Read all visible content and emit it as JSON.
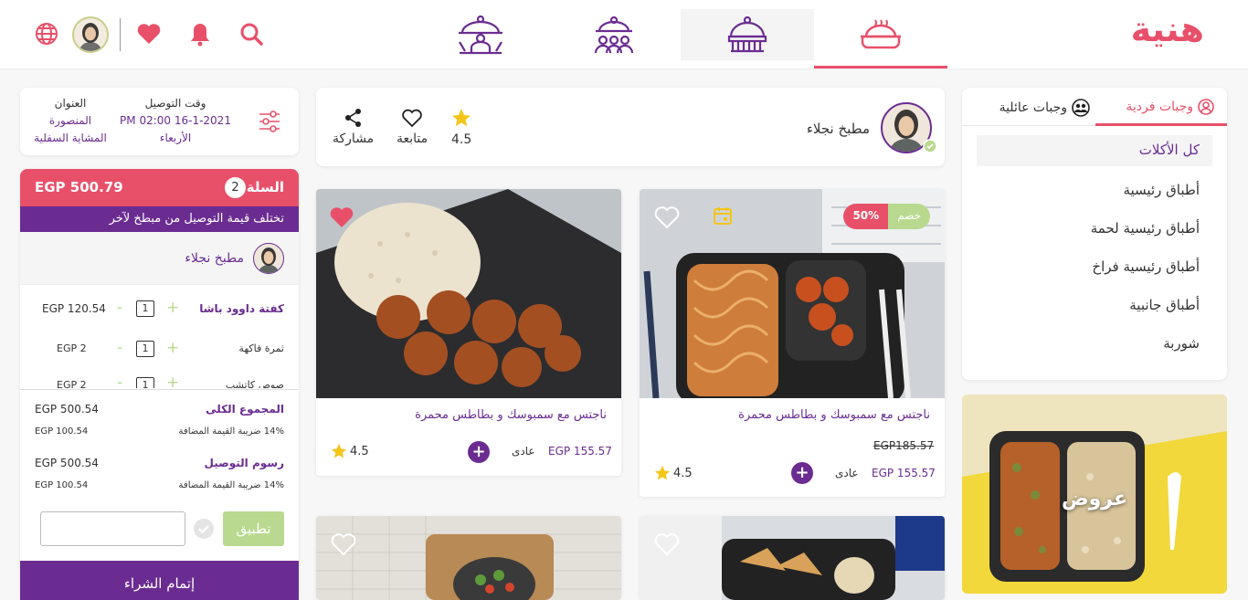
{
  "header": {
    "logo": "هنية",
    "nav_tabs": [
      {
        "name": "individual-meals",
        "icon": "covered-dish-icon"
      },
      {
        "name": "family-meals",
        "icon": "covered-dish-wide-icon"
      },
      {
        "name": "group-meals",
        "icon": "group-icon"
      },
      {
        "name": "waiter-meals",
        "icon": "waiter-icon"
      }
    ],
    "icons": [
      "search-icon",
      "bell-icon",
      "heart-icon",
      "globe-icon"
    ]
  },
  "categories": {
    "tab_individual": "وجبات فردية",
    "tab_family": "وجبات عائلية",
    "items": [
      "كل الأكلات",
      "أطباق رئيسية",
      "أطباق رئيسية لحمة",
      "أطباق رئيسية فراخ",
      "أطباق جانبية",
      "شوربة"
    ],
    "offers_label": "عروض"
  },
  "kitchen": {
    "name": "مطبخ نجلاء",
    "rating": "4.5",
    "follow_label": "متابعة",
    "share_label": "مشاركة"
  },
  "meals": [
    {
      "title": "ناجتس مع سمبوسك و بطاطس محمرة",
      "old_price": "EGP185.57",
      "price": "EGP 155.57",
      "type": "عادى",
      "rating": "4.5",
      "discount_label": "خصم",
      "discount_value": "50%"
    },
    {
      "title": "ناجتس مع سمبوسك و بطاطس محمرة",
      "price": "EGP 155.57",
      "type": "عادى",
      "rating": "4.5"
    }
  ],
  "delivery": {
    "address_label": "العنوان",
    "address_city": "المنصورة",
    "address_area": "المشاية السفلية",
    "time_label": "وقت التوصيل",
    "time_value": "PM 02:00 16-1-2021",
    "day": "الأربعاء"
  },
  "cart": {
    "title": "السلة",
    "count": "2",
    "total": "EGP 500.79",
    "notice": "تختلف قيمة التوصيل من مبطخ لآخر",
    "kitchen_name": "مطبخ نجلاء",
    "items": [
      {
        "name": "كفتة داوود باشا",
        "qty": "1",
        "price": "EGP 120.54"
      },
      {
        "name": "ثمرة فاكهة",
        "qty": "1",
        "price": "EGP 2"
      },
      {
        "name": "صوص كاتشب",
        "qty": "1",
        "price": "EGP 2"
      }
    ],
    "subtotal_label": "المجموع الكلى",
    "subtotal_value": "EGP 500.54",
    "vat_label": "14% ضريبة القيمة المضافة",
    "vat_value": "EGP 100.54",
    "delivery_label": "رسوم التوصيل",
    "delivery_value": "EGP 500.54",
    "delivery_vat_label": "14% ضريبة القيمة المضافة",
    "delivery_vat_value": "EGP 100.54",
    "apply_label": "تطبيق",
    "checkout_label": "إتمام الشراء"
  },
  "colors": {
    "brand_pink": "#e8506a",
    "brand_purple": "#6b2c91",
    "green": "#b9d98f"
  }
}
